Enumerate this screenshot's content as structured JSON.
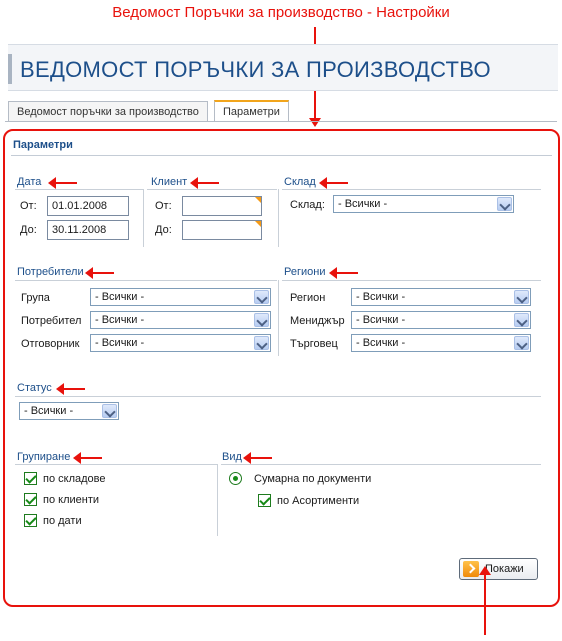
{
  "annotation": {
    "title": "Ведомост Поръчки за производство - Настройки"
  },
  "header": {
    "title": "ВЕДОМОСТ ПОРЪЧКИ ЗА ПРОИЗВОДСТВО"
  },
  "tabs": [
    {
      "label": "Ведомост поръчки за производство",
      "active": false
    },
    {
      "label": "Параметри",
      "active": true
    }
  ],
  "panel": {
    "title": "Параметри"
  },
  "date": {
    "heading": "Дата",
    "from_label": "От:",
    "from_value": "01.01.2008",
    "to_label": "До:",
    "to_value": "30.11.2008"
  },
  "client": {
    "heading": "Клиент",
    "from_label": "От:",
    "from_value": "",
    "to_label": "До:",
    "to_value": ""
  },
  "warehouse": {
    "heading": "Склад",
    "label": "Склад:",
    "value": "- Всички -"
  },
  "consumers": {
    "heading": "Потребители",
    "rows": [
      {
        "label": "Група",
        "value": "- Всички -"
      },
      {
        "label": "Потребител",
        "value": "- Всички -"
      },
      {
        "label": "Отговорник",
        "value": "- Всички -"
      }
    ]
  },
  "regions": {
    "heading": "Региони",
    "rows": [
      {
        "label": "Регион",
        "value": "- Всички -"
      },
      {
        "label": "Мениджър",
        "value": "- Всички -"
      },
      {
        "label": "Търговец",
        "value": "- Всички -"
      }
    ]
  },
  "status": {
    "heading": "Статус",
    "value": "- Всички -"
  },
  "grouping": {
    "heading": "Групиране",
    "options": [
      {
        "label": "по складове",
        "checked": true
      },
      {
        "label": "по клиенти",
        "checked": true
      },
      {
        "label": "по дати",
        "checked": true
      }
    ]
  },
  "view": {
    "heading": "Вид",
    "radio_label": "Сумарна по документи",
    "radio_selected": true,
    "sub_check_label": "по Асортименти",
    "sub_checked": true
  },
  "actions": {
    "show_label": "Покажи"
  },
  "colors": {
    "annotation_red": "#e8120c",
    "title_blue": "#1d4f8a",
    "tab_accent": "#f2a51c",
    "check_green": "#178a17"
  },
  "icons": [
    "dropdown-arrow-icon",
    "required-corner-icon",
    "checkbox-checked-icon",
    "radio-selected-icon",
    "go-arrow-icon",
    "annotation-arrow-icon"
  ]
}
